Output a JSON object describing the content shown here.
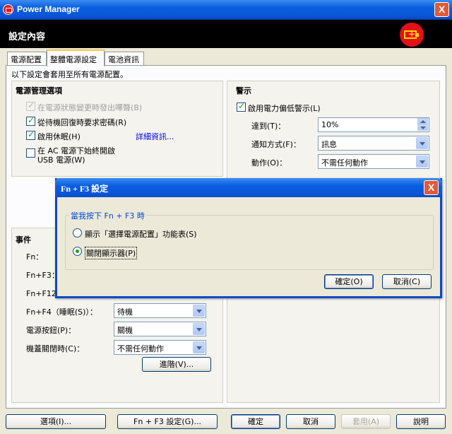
{
  "window": {
    "title": "Power Manager",
    "close": "X"
  },
  "banner": {
    "title": "設定內容"
  },
  "tabs": [
    {
      "label": "電源配置"
    },
    {
      "label": "整體電源設定"
    },
    {
      "label": "電池資訊"
    }
  ],
  "intro": "以下設定會套用至所有電源配置。",
  "power_options": {
    "title": "電源管理選項",
    "beep": "在電源狀態變更時發出嗶聲(B)",
    "password": "從待機回復時要求密碼(R)",
    "hibernate": "啟用休眠(H)",
    "details_link": "詳細資訊...",
    "usb_line1": "在 AC 電源下始終開啟",
    "usb_line2": "USB 電源(W)"
  },
  "alarm": {
    "title": "警示",
    "enable": "啟用電力偏低警示(L)",
    "reach_label": "達到(T)：",
    "reach_value": "10%",
    "notify_label": "通知方式(F)：",
    "notify_value": "訊息",
    "action_label": "動作(O)：",
    "action_value": "不需任何動作"
  },
  "events": {
    "title": "事件",
    "fn": "Fn：",
    "fn_f3": "Fn+F3：",
    "fn_f12": "Fn+F12：",
    "fn_f4_label": "Fn+F4（睡眠(S)）：",
    "fn_f4_value": "待機",
    "power_btn_label": "電源按鈕(P)：",
    "power_btn_value": "關機",
    "lid_label": "機蓋關閉時(C)：",
    "lid_value": "不需任何動作",
    "advanced": "進階(V)..."
  },
  "dialog": {
    "title": "Fn + F3 設定",
    "group": "當我按下 Fn + F3 時",
    "option1": "顯示「選擇電源配置」功能表(S)",
    "option2": "關閉顯示器(P)",
    "ok": "確定(O)",
    "cancel": "取消(C)"
  },
  "footer": {
    "options": "選項(I)...",
    "fnf3": "Fn + F3 設定(G)...",
    "ok": "確定",
    "cancel": "取消",
    "apply": "套用(A)",
    "help": "說明"
  }
}
